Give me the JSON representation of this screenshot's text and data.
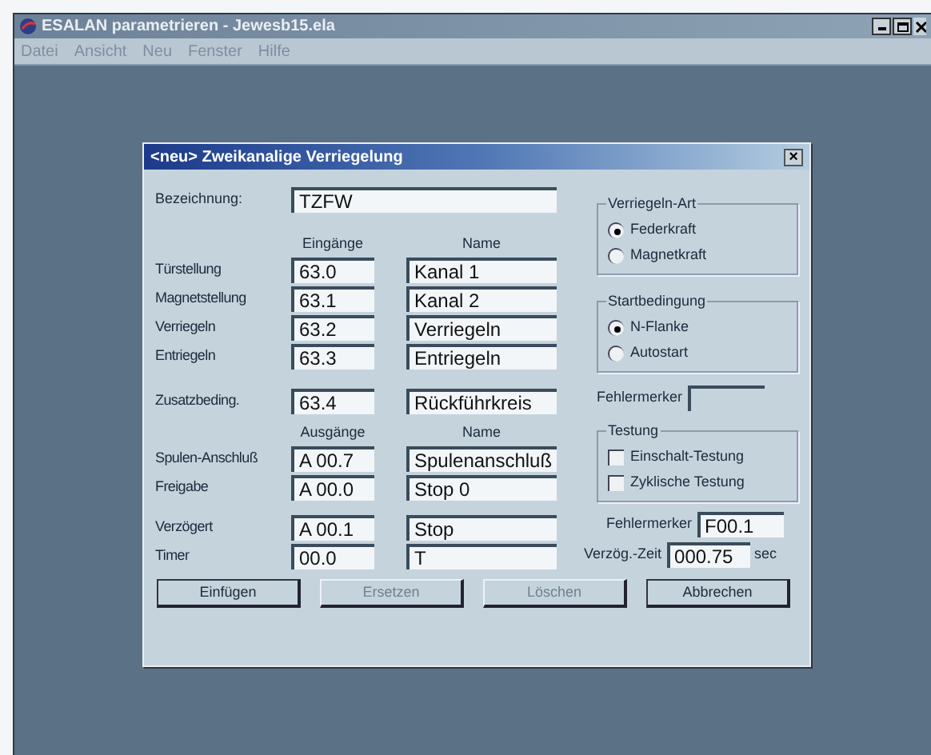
{
  "window": {
    "title": "ESALAN parametrieren - Jewesb15.ela"
  },
  "menu": [
    "Datei",
    "Ansicht",
    "Neu",
    "Fenster",
    "Hilfe"
  ],
  "dialog": {
    "title": "<neu> Zweikanalige Verriegelung",
    "close": "×",
    "designation": {
      "label": "Bezeichnung:",
      "value": "TZFW"
    },
    "input_headers": [
      "Eingänge",
      "Name"
    ],
    "inputs": [
      {
        "label": "Türstellung",
        "address": "63.0",
        "name": "Kanal 1"
      },
      {
        "label": "Magnetstellung",
        "address": "63.1",
        "name": "Kanal 2"
      },
      {
        "label": "Verriegeln",
        "address": "63.2",
        "name": "Verriegeln"
      },
      {
        "label": "Entriegeln",
        "address": "63.3",
        "name": "Entriegeln"
      }
    ],
    "extra_input": {
      "label": "Zusatzbeding.",
      "address": "63.4",
      "name": "Rückführkreis"
    },
    "output_headers": [
      "Ausgänge",
      "Name"
    ],
    "outputs": [
      {
        "label": "Spulen-Anschluß",
        "address": "A 00.7",
        "name": "Spulenanschluß"
      },
      {
        "label": "Freigabe",
        "address": "A 00.0",
        "name": "Stop 0"
      }
    ],
    "delay_rows": [
      {
        "label": "Verzögert",
        "address": "A 00.1",
        "name": "Stop"
      },
      {
        "label": "Timer",
        "address": "00.0",
        "name": "T"
      }
    ],
    "lock_type": {
      "title": "Verriegeln-Art",
      "options": [
        {
          "label": "Federkraft",
          "selected": true
        },
        {
          "label": "Magnetkraft",
          "selected": false
        }
      ]
    },
    "start_condition": {
      "title": "Startbedingung",
      "options": [
        {
          "label": "N-Flanke",
          "selected": true
        },
        {
          "label": "Autostart",
          "selected": false
        }
      ]
    },
    "error_flag_1": {
      "label": "Fehlermerker"
    },
    "testing": {
      "title": "Testung",
      "options": [
        {
          "label": "Einschalt-Testung",
          "checked": false
        },
        {
          "label": "Zyklische Testung",
          "checked": false
        }
      ]
    },
    "error_flag_2": {
      "label": "Fehlermerker",
      "value": "F00.1"
    },
    "delay_time": {
      "label": "Verzög.-Zeit",
      "value": "000.75",
      "unit": "sec"
    },
    "buttons": [
      {
        "label": "Einfügen",
        "disabled": false
      },
      {
        "label": "Ersetzen",
        "disabled": true
      },
      {
        "label": "Löschen",
        "disabled": true
      },
      {
        "label": "Abbrechen",
        "disabled": false
      }
    ]
  }
}
